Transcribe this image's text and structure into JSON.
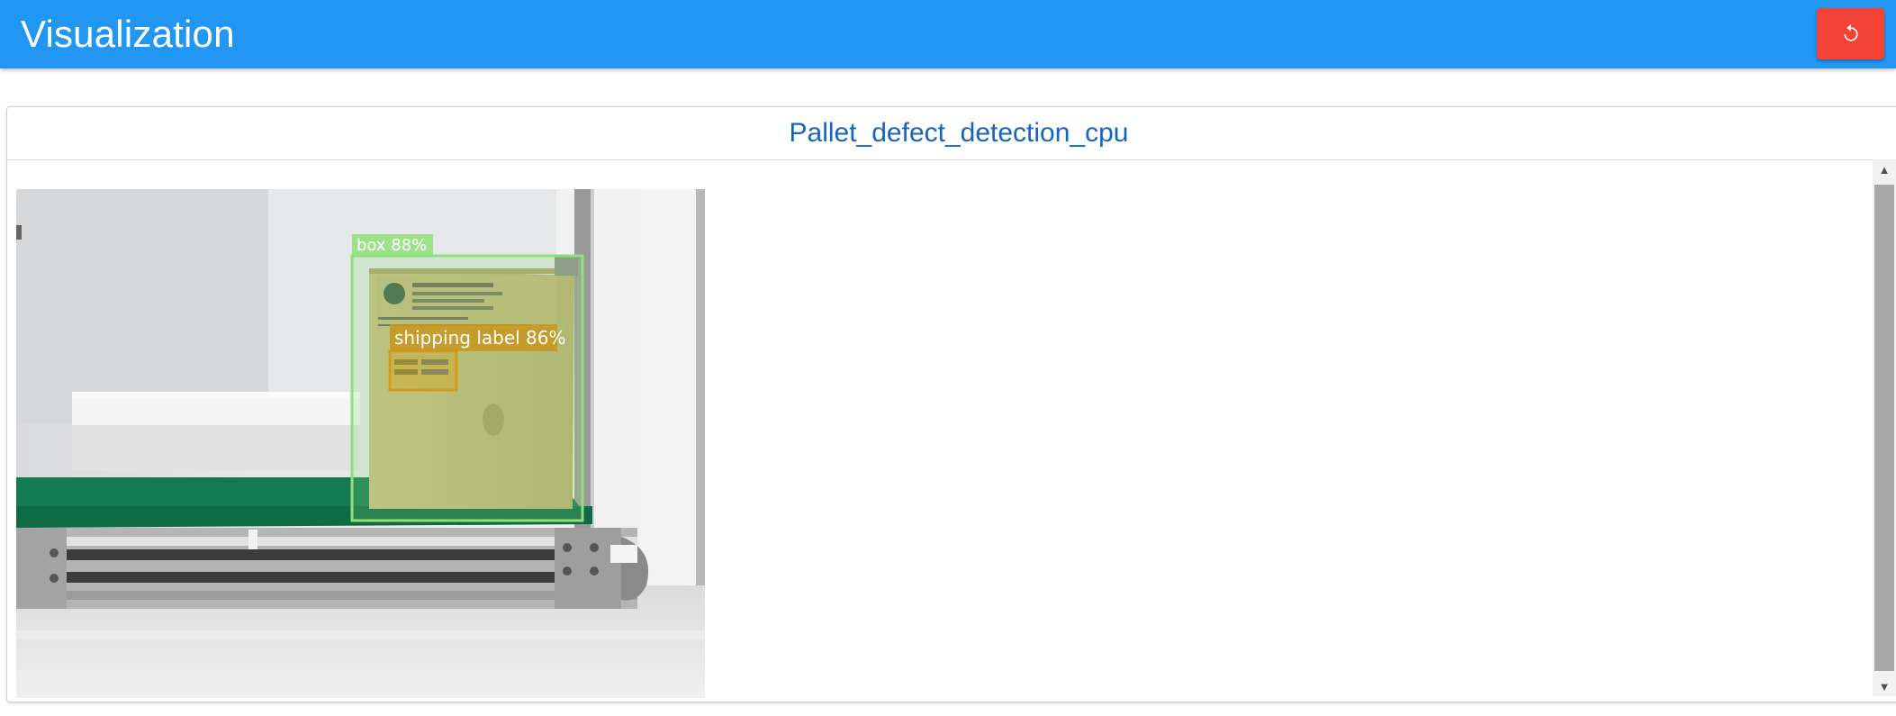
{
  "header": {
    "title": "Visualization",
    "reset_icon": "refresh-icon",
    "accent": "#2196f3",
    "reset_color": "#f44336"
  },
  "panel": {
    "title": "Pallet_defect_detection_cpu",
    "detections": [
      {
        "label": "box 88%",
        "color": "#8fe07a"
      },
      {
        "label": "shipping label 86%",
        "color": "#d49a1a"
      }
    ]
  }
}
